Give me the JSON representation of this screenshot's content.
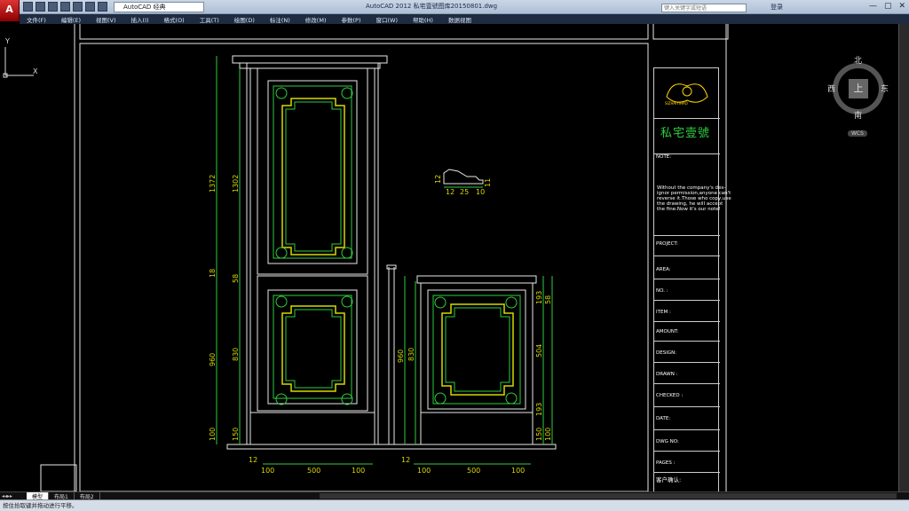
{
  "app": {
    "title": "AutoCAD 2012  私宅壹號图库20150801.dwg",
    "title_parts": [
      "AutoCAD 2012",
      "私宅壹號图库20150801.dwg"
    ],
    "logo": "A",
    "workspace": "AutoCAD 经典",
    "search_placeholder": "键入关键字或短语",
    "login_label": "登录",
    "window_controls": [
      "—",
      "▢",
      "✕"
    ]
  },
  "menu": [
    "文件(F)",
    "编辑(E)",
    "视图(V)",
    "插入(I)",
    "格式(O)",
    "工具(T)",
    "绘图(D)",
    "标注(N)",
    "修改(M)",
    "参数(P)",
    "窗口(W)",
    "帮助(H)",
    "数据视图"
  ],
  "ucs": {
    "x_label": "X",
    "y_label": "Y"
  },
  "viewcube": {
    "north": "北",
    "south": "南",
    "east": "东",
    "west": "西",
    "top": "上",
    "wcs": "WCS"
  },
  "drawing": {
    "dimensions_left_cabinet": [
      "1372",
      "1302",
      "18",
      "58",
      "960",
      "830",
      "100",
      "150"
    ],
    "dimensions_right_cabinet": [
      "960",
      "830",
      "193",
      "58",
      "504",
      "193",
      "150",
      "100"
    ],
    "bottom_dims_left": [
      "12",
      "100",
      "500",
      "100"
    ],
    "bottom_dims_right": [
      "12",
      "100",
      "500",
      "100"
    ],
    "profile_dims": [
      "12",
      "11",
      "12",
      "25",
      "10",
      "10"
    ]
  },
  "title_block": {
    "logo_text": "SIZHAIYIHAO",
    "brand": "私宅壹號",
    "note_label": "NOTE:",
    "note_text": "Without the company's des-\nignor permission,anyone can't\nreverse it.Those who copy,use\nthe drawing, he will accept\nthe fine.Now it's our note!",
    "fields": [
      {
        "label": "PROJECT:"
      },
      {
        "label": "AREA:"
      },
      {
        "label": "NO. :"
      },
      {
        "label": "ITEM :"
      },
      {
        "label": "AMOUNT:"
      },
      {
        "label": "DESIGN:"
      },
      {
        "label": "DRAWN :"
      },
      {
        "label": "CHECKED :"
      },
      {
        "label": "DATE:"
      },
      {
        "label": "DWG NO:"
      },
      {
        "label": "PAGES :"
      }
    ],
    "client_confirm": "客户确认:"
  },
  "tabs": {
    "items": [
      "模型",
      "布局1",
      "布局2"
    ],
    "active": "模型"
  },
  "status": {
    "prompt": "按住拾取键并拖动进行平移。"
  },
  "colors": {
    "line_white": "#e8e8e8",
    "line_green": "#2ecc40",
    "line_yellow": "#d8d800",
    "background": "#000000"
  }
}
